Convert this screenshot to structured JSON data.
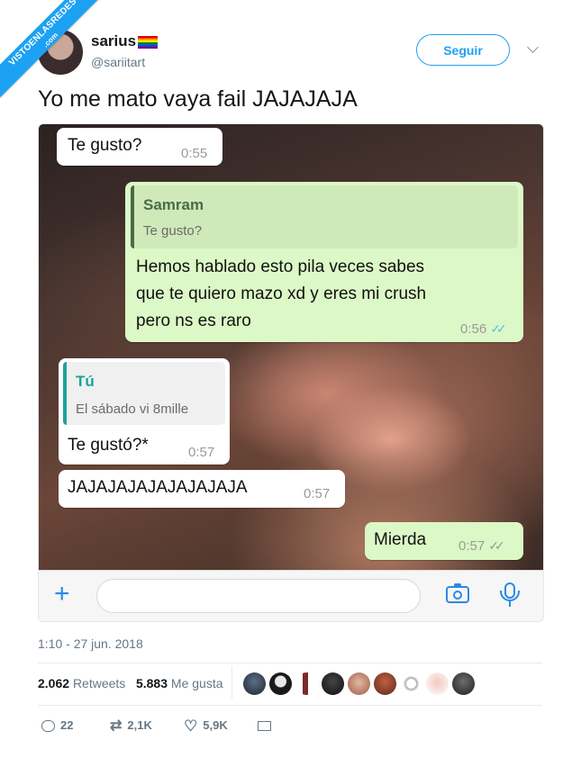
{
  "watermark": {
    "line1": "VISTOENLASREDES",
    "line2": ".com"
  },
  "user": {
    "display_name": "sarius",
    "handle": "@sariitart"
  },
  "follow_label": "Seguir",
  "tweet_text": "Yo me mato vaya fail JAJAJAJA",
  "chat": {
    "m1": {
      "text": "Te gusto?",
      "time": "0:55"
    },
    "m2": {
      "quote_author": "Samram",
      "quote_text": "Te gusto?",
      "lines": [
        "Hemos hablado esto pila veces sabes",
        "que te quiero mazo xd y eres mi crush",
        "pero ns es raro"
      ],
      "time": "0:56"
    },
    "m3": {
      "quote_author": "Tú",
      "quote_text": "El sábado vi 8mille",
      "text": "Te gustó?*",
      "time": "0:57"
    },
    "m4": {
      "text": "JAJAJAJAJAJAJAJAJA",
      "time": "0:57"
    },
    "m5": {
      "text": "Mierda",
      "time": "0:57"
    }
  },
  "timestamp": "1:10 - 27 jun. 2018",
  "stats": {
    "retweets_count": "2.062",
    "retweets_label": "Retweets",
    "likes_count": "5.883",
    "likes_label": "Me gusta"
  },
  "actions": {
    "replies": "22",
    "retweets": "2,1K",
    "likes": "5,9K"
  },
  "colors": {
    "accent": "#1da1f2",
    "bubble_out": "#dcf8c6",
    "quote_out_author": "#4a6b4a",
    "quote_in_author": "#1aa39a"
  }
}
